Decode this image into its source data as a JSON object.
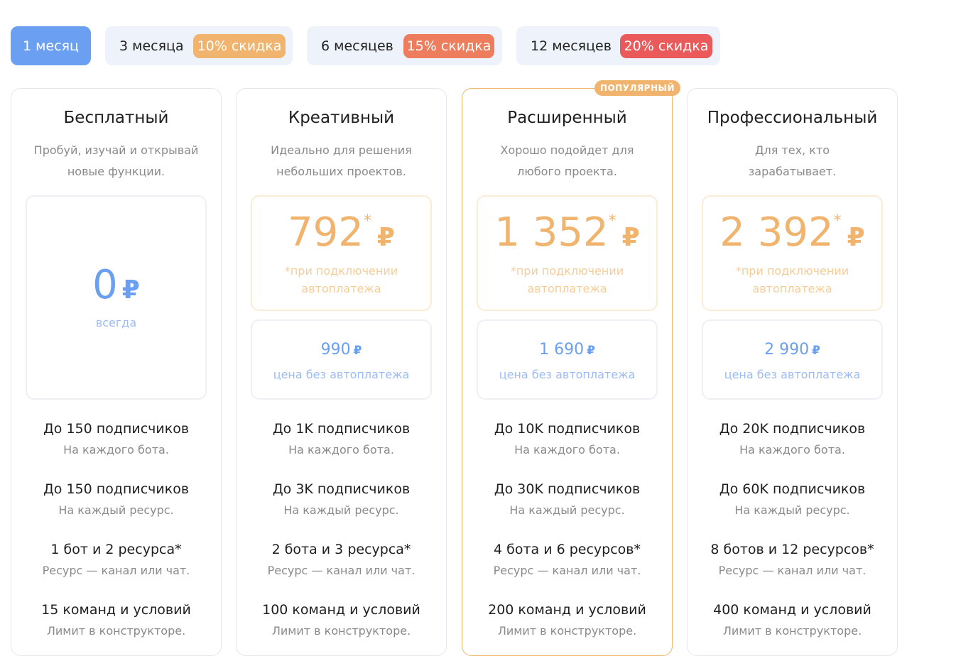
{
  "periods": [
    {
      "label": "1 месяц",
      "active": true
    },
    {
      "label": "3 месяца",
      "badge": "10% скидка",
      "badge_color": "#f0b46e"
    },
    {
      "label": "6 месяцев",
      "badge": "15% скидка",
      "badge_color": "#ee7d5e"
    },
    {
      "label": "12 месяцев",
      "badge": "20% скидка",
      "badge_color": "#ea5a5a"
    }
  ],
  "currency": "₽",
  "popular_tag": "ПОПУЛЯРНЫЙ",
  "plans": [
    {
      "title": "Бесплатный",
      "desc_1": "Пробуй, изучай и открывай",
      "desc_2": "новые функции.",
      "price": "0",
      "price_note": "всегда",
      "features": [
        {
          "main": "До 150 подписчиков",
          "sub": "На каждого бота."
        },
        {
          "main": "До 150 подписчиков",
          "sub": "На каждый ресурс."
        },
        {
          "main": "1 бот и 2 ресурса*",
          "sub": "Ресурс — канал или чат."
        },
        {
          "main": "15 команд и условий",
          "sub": "Лимит в конструкторе."
        }
      ]
    },
    {
      "title": "Креативный",
      "desc_1": "Идеально для решения",
      "desc_2": "небольших проектов.",
      "price": "792",
      "star": "*",
      "price_note_1": "*при подключении",
      "price_note_2": "автоплатежа",
      "alt_price": "990",
      "alt_note": "цена без автоплатежа",
      "features": [
        {
          "main": "До 1K подписчиков",
          "sub": "На каждого бота."
        },
        {
          "main": "До 3K подписчиков",
          "sub": "На каждый ресурс."
        },
        {
          "main": "2 бота и 3 ресурса*",
          "sub": "Ресурс — канал или чат."
        },
        {
          "main": "100 команд и условий",
          "sub": "Лимит в конструкторе."
        }
      ]
    },
    {
      "title": "Расширенный",
      "desc_1": "Хорошо подойдет для",
      "desc_2": "любого проекта.",
      "price": "1 352",
      "star": "*",
      "price_note_1": "*при подключении",
      "price_note_2": "автоплатежа",
      "alt_price": "1 690",
      "alt_note": "цена без автоплатежа",
      "popular": true,
      "features": [
        {
          "main": "До 10K подписчиков",
          "sub": "На каждого бота."
        },
        {
          "main": "До 30K подписчиков",
          "sub": "На каждый ресурс."
        },
        {
          "main": "4 бота и 6 ресурсов*",
          "sub": "Ресурс — канал или чат."
        },
        {
          "main": "200 команд и условий",
          "sub": "Лимит в конструкторе."
        }
      ]
    },
    {
      "title": "Профессиональный",
      "desc_1": "Для тех, кто",
      "desc_2": "зарабатывает.",
      "price": "2 392",
      "star": "*",
      "price_note_1": "*при подключении",
      "price_note_2": "автоплатежа",
      "alt_price": "2 990",
      "alt_note": "цена без автоплатежа",
      "features": [
        {
          "main": "До 20K подписчиков",
          "sub": "На каждого бота."
        },
        {
          "main": "До 60K подписчиков",
          "sub": "На каждый ресурс."
        },
        {
          "main": "8 ботов и 12 ресурсов*",
          "sub": "Ресурс — канал или чат."
        },
        {
          "main": "400 команд и условий",
          "sub": "Лимит в конструкторе."
        }
      ]
    }
  ]
}
